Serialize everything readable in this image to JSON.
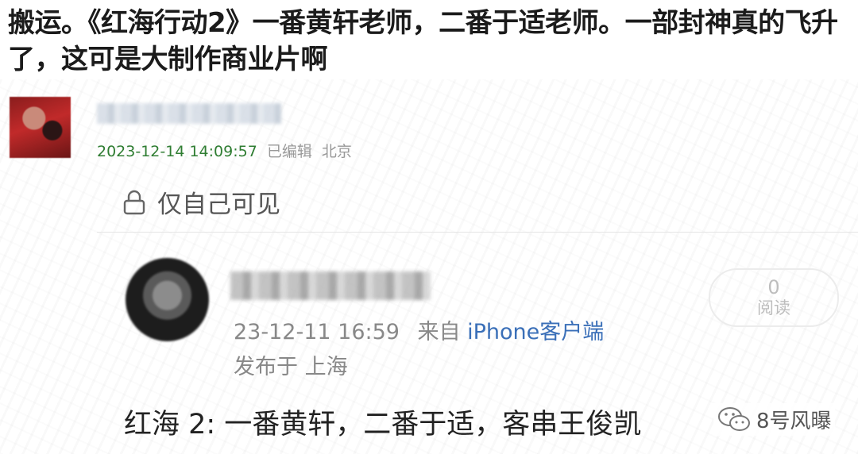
{
  "headline": "搬运。《红海行动2》一番黄轩老师，二番于适老师。一部封神真的飞升了，这可是大制作商业片啊",
  "post_header": {
    "timestamp": "2023-12-14 14:09:57",
    "edited": "已编辑",
    "location": "北京"
  },
  "visibility": {
    "icon": "lock-icon",
    "label": "仅自己可见"
  },
  "shared_post": {
    "time": "23-12-11 16:59",
    "source_prefix": "来自",
    "device": "iPhone客户端",
    "location": "发布于 上海",
    "read_count": "0",
    "read_label": "阅读",
    "body": "红海 2: 一番黄轩，二番于适，客串王俊凯"
  },
  "watermark": {
    "icon": "wechat-icon",
    "label": "8号风曝"
  },
  "colors": {
    "timestamp_green": "#2f7d32",
    "device_blue": "#3a6fb8"
  }
}
